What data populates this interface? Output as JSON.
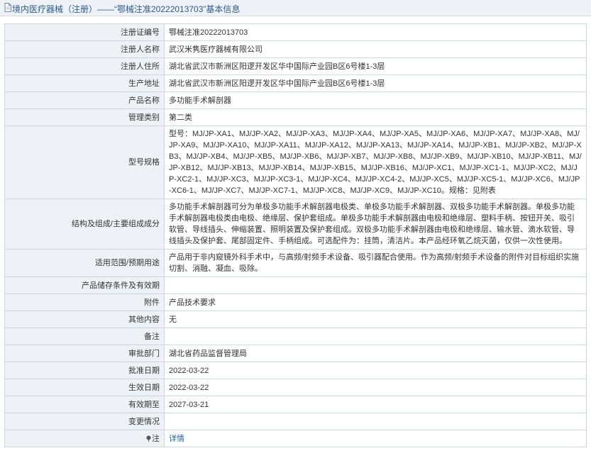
{
  "header": {
    "title": "境内医疗器械（注册）——“鄂械注准20222013703”基本信息"
  },
  "rows": [
    {
      "label": "注册证编号",
      "value": "鄂械注准20222013703"
    },
    {
      "label": "注册人名称",
      "value": "武汉米隽医疗器械有限公司"
    },
    {
      "label": "注册人住所",
      "value": "湖北省武汉市新洲区阳逻开发区华中国际产业园B区6号楼1-3层"
    },
    {
      "label": "生产地址",
      "value": "湖北省武汉市新洲区阳逻开发区华中国际产业园B区6号楼1-3层"
    },
    {
      "label": "产品名称",
      "value": "多功能手术解剖器"
    },
    {
      "label": "管理类别",
      "value": "第二类"
    },
    {
      "label": "型号规格",
      "value": "型号：MJ/JP-XA1、MJ/JP-XA2、MJ/JP-XA3、MJ/JP-XA4、MJ/JP-XA5、MJ/JP-XA6、MJ/JP-XA7、MJ/JP-XA8、MJ/JP-XA9、MJ/JP-XA10、MJ/JP-XA11、MJ/JP-XA12、MJ/JP-XA13、MJ/JP-XA14、MJ/JP-XB1、MJ/JP-XB2、MJ/JP-XB3、MJ/JP-XB4、MJ/JP-XB5、MJ/JP-XB6、MJ/JP-XB7、MJ/JP-XB8、MJ/JP-XB9、MJ/JP-XB10、MJ/JP-XB11、MJ/JP-XB12、MJ/JP-XB13、MJ/JP-XB14、MJ/JP-XB15、MJ/JP-XB16、MJ/JP-XC1、MJ/JP-XC1-1、MJ/JP-XC2、MJ/JP-XC2-1、MJ/JP-XC3、MJ/JP-XC3-1、MJ/JP-XC4、MJ/JP-XC4-2、MJ/JP-XC5、MJ/JP-XC5-1、MJ/JP-XC6、MJ/JP-XC6-1、MJ/JP-XC7、MJ/JP-XC7-1、MJ/JP-XC8、MJ/JP-XC9、MJ/JP-XC10。规格：见附表"
    },
    {
      "label": "结构及组成/主要组成成分",
      "value": "多功能手术解剖器可分为单极多功能手术解剖器电极类、单极多功能手术解剖器、双极多功能手术解剖器。单极多功能手术解剖器电极类由电极、绝缘层、保护套组成。单极多功能手术解剖器由电极和绝缘层、塑料手柄、按钮开关、吸引软管、导线插头、伸缩装置、照明装置及保护套组成。双极多功能手术解剖器由电极和绝缘层、输水管、滴水软管、导线插头及保护套、尾部固定件、手柄组成。可选配件为：挂筒，清洁片。本产品经环氧乙烷灭菌，仅供一次性使用。"
    },
    {
      "label": "适用范围/预期用途",
      "value": "产品用于非内窥镜外科手术中，与高频/射频手术设备、吸引器配合使用。作为高频/射频手术设备的附件对目标组织实施切割、消融、凝血、吸除。"
    },
    {
      "label": "产品储存条件及有效期",
      "value": ""
    },
    {
      "label": "附件",
      "value": "产品技术要求"
    },
    {
      "label": "其他内容",
      "value": "无"
    },
    {
      "label": "备注",
      "value": ""
    },
    {
      "label": "审批部门",
      "value": "湖北省药品监督管理局"
    },
    {
      "label": "批准日期",
      "value": "2022-03-22"
    },
    {
      "label": "生效日期",
      "value": "2022-03-22"
    },
    {
      "label": "有效期至",
      "value": "2027-03-21"
    },
    {
      "label": "变更情况",
      "value": ""
    }
  ],
  "note": {
    "label": "注",
    "link": "详情"
  },
  "colors": {
    "label_bg": "#eef2f6",
    "border": "#cfd6de",
    "link": "#1f5fa8",
    "title": "#2c5a8c"
  }
}
